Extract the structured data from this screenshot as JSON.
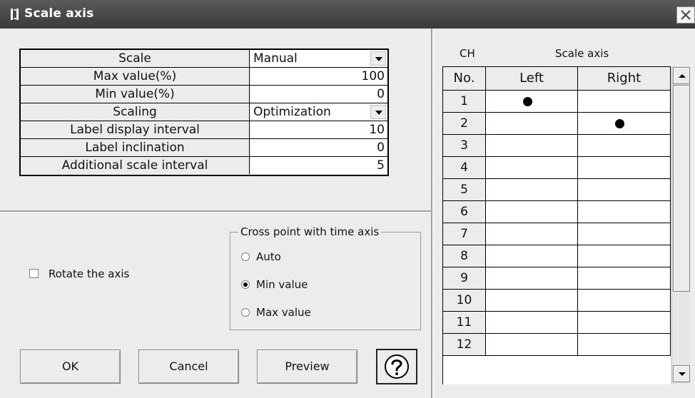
{
  "window": {
    "title": "Scale axis",
    "close_label": "×"
  },
  "properties": [
    {
      "label": "Scale",
      "value": "Manual",
      "kind": "combo"
    },
    {
      "label": "Max value(%)",
      "value": "100",
      "kind": "number"
    },
    {
      "label": "Min value(%)",
      "value": "0",
      "kind": "number"
    },
    {
      "label": "Scaling",
      "value": "Optimization",
      "kind": "combo"
    },
    {
      "label": "Label display interval",
      "value": "10",
      "kind": "number"
    },
    {
      "label": "Label inclination",
      "value": "0",
      "kind": "number"
    },
    {
      "label": "Additional scale interval",
      "value": "5",
      "kind": "number"
    }
  ],
  "rotate_axis": {
    "label": "Rotate the axis",
    "checked": false
  },
  "cross_point": {
    "title": "Cross point with time axis",
    "options": [
      {
        "label": "Auto",
        "selected": false
      },
      {
        "label": "Min value",
        "selected": true
      },
      {
        "label": "Max value",
        "selected": false
      }
    ]
  },
  "buttons": {
    "ok": "OK",
    "cancel": "Cancel",
    "preview": "Preview",
    "help_icon": "question-mark-icon"
  },
  "channel_table": {
    "ch_header": "CH",
    "scale_axis_header": "Scale axis",
    "columns": [
      "No.",
      "Left",
      "Right"
    ],
    "rows": [
      {
        "no": "1",
        "axis": "left"
      },
      {
        "no": "2",
        "axis": "right"
      },
      {
        "no": "3",
        "axis": ""
      },
      {
        "no": "4",
        "axis": ""
      },
      {
        "no": "5",
        "axis": ""
      },
      {
        "no": "6",
        "axis": ""
      },
      {
        "no": "7",
        "axis": ""
      },
      {
        "no": "8",
        "axis": ""
      },
      {
        "no": "9",
        "axis": ""
      },
      {
        "no": "10",
        "axis": ""
      },
      {
        "no": "11",
        "axis": ""
      },
      {
        "no": "12",
        "axis": ""
      }
    ]
  },
  "colors": {
    "titlebar": "#3a3a3a",
    "dialog_bg": "#ececec",
    "cell_bg": "#ffffff"
  }
}
